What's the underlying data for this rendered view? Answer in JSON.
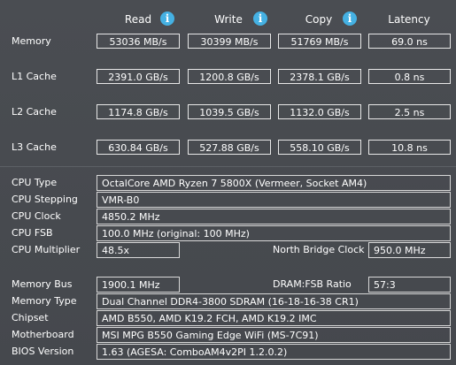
{
  "headers": {
    "read": "Read",
    "write": "Write",
    "copy": "Copy",
    "latency": "Latency"
  },
  "info_icon_glyph": "i",
  "bench": [
    {
      "label": "Memory",
      "read": "53036 MB/s",
      "write": "30399 MB/s",
      "copy": "51769 MB/s",
      "latency": "69.0 ns"
    },
    {
      "label": "L1 Cache",
      "read": "2391.0 GB/s",
      "write": "1200.8 GB/s",
      "copy": "2378.1 GB/s",
      "latency": "0.8 ns"
    },
    {
      "label": "L2 Cache",
      "read": "1174.8 GB/s",
      "write": "1039.5 GB/s",
      "copy": "1132.0 GB/s",
      "latency": "2.5 ns"
    },
    {
      "label": "L3 Cache",
      "read": "630.84 GB/s",
      "write": "527.88 GB/s",
      "copy": "558.10 GB/s",
      "latency": "10.8 ns"
    }
  ],
  "cpu": {
    "type_label": "CPU Type",
    "type": "OctalCore AMD Ryzen 7 5800X  (Vermeer, Socket AM4)",
    "stepping_label": "CPU Stepping",
    "stepping": "VMR-B0",
    "clock_label": "CPU Clock",
    "clock": "4850.2 MHz",
    "fsb_label": "CPU FSB",
    "fsb": "100.0 MHz  (original: 100 MHz)",
    "multiplier_label": "CPU Multiplier",
    "multiplier": "48.5x",
    "nb_clock_label": "North Bridge Clock",
    "nb_clock": "950.0 MHz"
  },
  "memory": {
    "bus_label": "Memory Bus",
    "bus": "1900.1 MHz",
    "ratio_label": "DRAM:FSB Ratio",
    "ratio": "57:3",
    "type_label": "Memory Type",
    "type": "Dual Channel DDR4-3800 SDRAM  (16-18-16-38 CR1)",
    "chipset_label": "Chipset",
    "chipset": "AMD B550, AMD K19.2 FCH, AMD K19.2 IMC",
    "motherboard_label": "Motherboard",
    "motherboard": "MSI MPG B550 Gaming Edge WiFi (MS-7C91)",
    "bios_label": "BIOS Version",
    "bios": "1.63  (AGESA: ComboAM4v2PI 1.2.0.2)"
  },
  "colors": {
    "background": "#474a4f",
    "info_icon": "#45b1e3",
    "text": "#ffffff",
    "border": "#e0e0e0"
  }
}
